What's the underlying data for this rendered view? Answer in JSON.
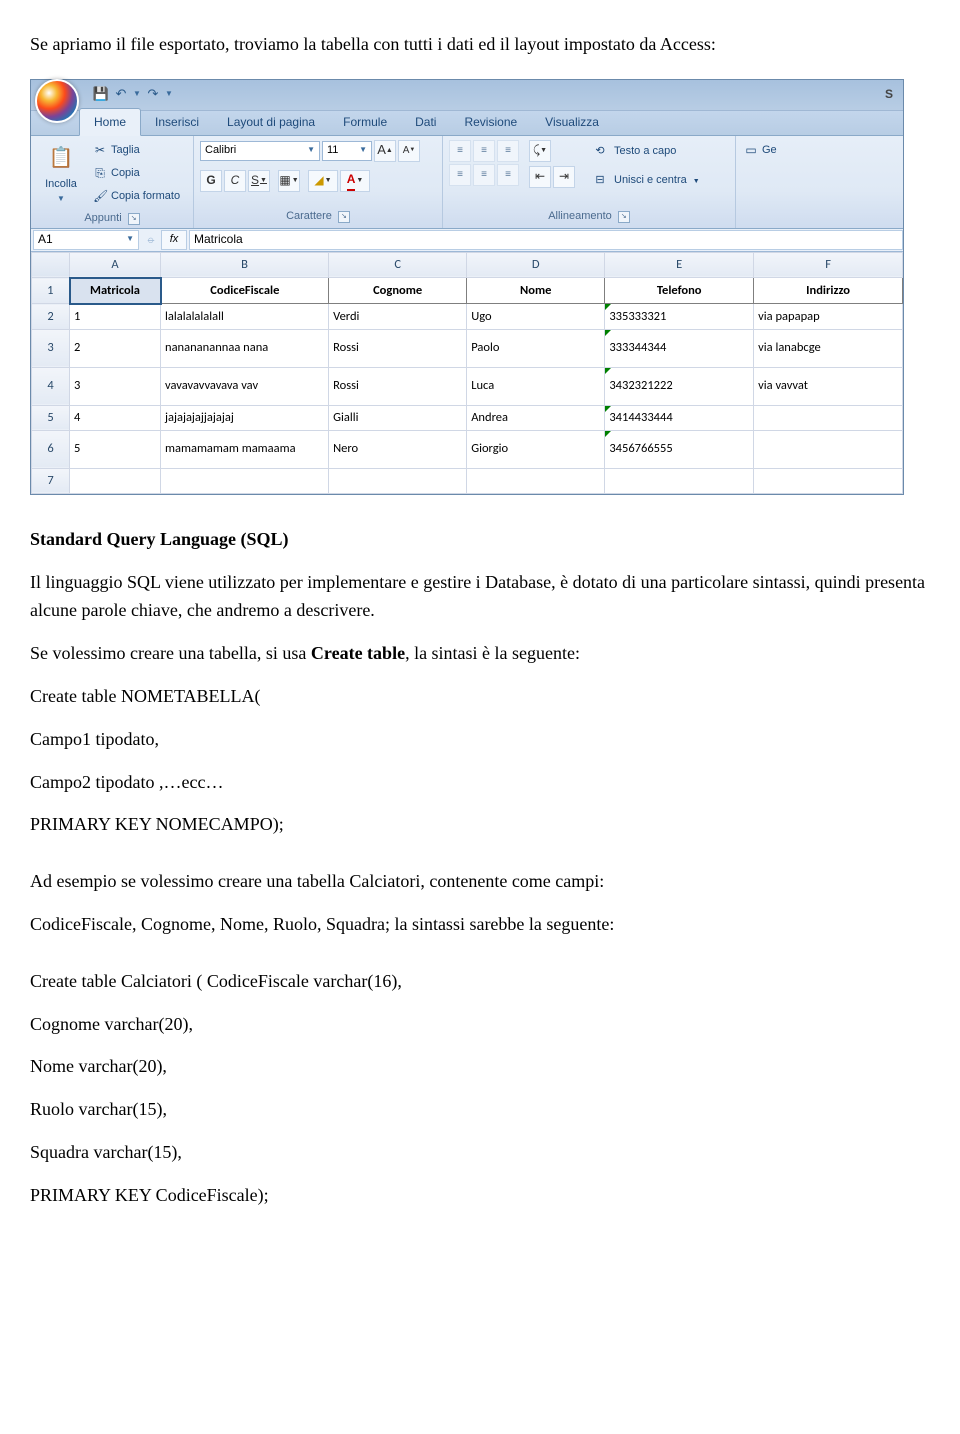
{
  "intro": "Se apriamo il file esportato, troviamo la tabella con tutti i dati ed il layout impostato da Access:",
  "excel": {
    "titlebar_right": "S",
    "tabs": [
      "Home",
      "Inserisci",
      "Layout di pagina",
      "Formule",
      "Dati",
      "Revisione",
      "Visualizza"
    ],
    "clipboard": {
      "paste": "Incolla",
      "cut": "Taglia",
      "copy": "Copia",
      "format_painter": "Copia formato",
      "group": "Appunti"
    },
    "font": {
      "name": "Calibri",
      "size": "11",
      "group": "Carattere",
      "bold": "G",
      "italic": "C",
      "underline": "S"
    },
    "align": {
      "wrap": "Testo a capo",
      "merge": "Unisci e centra",
      "group": "Allineamento"
    },
    "right_cut": "Ge",
    "namebox": "A1",
    "formula": "Matricola",
    "cols": [
      "A",
      "B",
      "C",
      "D",
      "E",
      "F"
    ],
    "headers": [
      "Matricola",
      "CodiceFiscale",
      "Cognome",
      "Nome",
      "Telefono",
      "Indirizzo"
    ],
    "rows": [
      {
        "n": "1",
        "mat": "1",
        "cf": "lalalalalalall",
        "cogn": "Verdi",
        "nome": "Ugo",
        "tel": "335333321",
        "ind": "via papapap"
      },
      {
        "n": "2",
        "mat": "2",
        "cf": "nanananannaa nana",
        "cogn": "Rossi",
        "nome": "Paolo",
        "tel": "333344344",
        "ind": "via lanabcge"
      },
      {
        "n": "3",
        "mat": "3",
        "cf": "vavavavvavava vav",
        "cogn": "Rossi",
        "nome": "Luca",
        "tel": "3432321222",
        "ind": "via vavvat"
      },
      {
        "n": "4",
        "mat": "4",
        "cf": "jajajajajjajajaj",
        "cogn": "Gialli",
        "nome": "Andrea",
        "tel": "3414433444",
        "ind": ""
      },
      {
        "n": "5",
        "mat": "5",
        "cf": "mamamamam mamaama",
        "cogn": "Nero",
        "nome": "Giorgio",
        "tel": "3456766555",
        "ind": ""
      }
    ]
  },
  "body": {
    "h1_a": "Standard Query Language (SQL)",
    "p1": "Il linguaggio SQL viene utilizzato per implementare e gestire i Database, è dotato di una particolare sintassi, quindi presenta alcune parole chiave, che andremo a descrivere.",
    "p2a": "Se volessimo creare una tabella, si usa ",
    "p2b": "Create table",
    "p2c": ", la sintasi è la seguente:",
    "c1": "Create table NOMETABELLA(",
    "c2": "Campo1 tipodato,",
    "c3": "Campo2 tipodato ,…ecc…",
    "c4": "PRIMARY KEY   NOMECAMPO);",
    "p3": "Ad esempio se volessimo creare una tabella Calciatori, contenente come campi:",
    "p4": "CodiceFiscale, Cognome, Nome, Ruolo, Squadra; la sintassi sarebbe la seguente:",
    "c5": "Create table Calciatori ( CodiceFiscale varchar(16),",
    "c6": "Cognome varchar(20),",
    "c7": "Nome varchar(20),",
    "c8": "Ruolo varchar(15),",
    "c9": "Squadra varchar(15),",
    "c10": "PRIMARY KEY CodiceFiscale);"
  }
}
